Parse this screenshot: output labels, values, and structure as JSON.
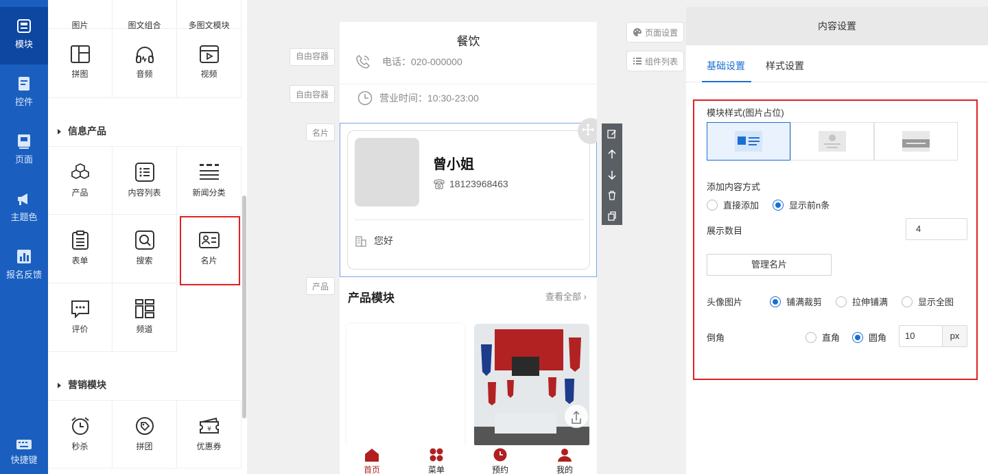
{
  "nav": {
    "items": [
      {
        "label": "模块",
        "icon": "module-icon"
      },
      {
        "label": "控件",
        "icon": "widget-icon"
      },
      {
        "label": "页面",
        "icon": "page-icon"
      },
      {
        "label": "主题色",
        "icon": "megaphone-icon"
      },
      {
        "label": "报名反馈",
        "icon": "chart-icon"
      },
      {
        "label": "快捷键",
        "icon": "keyboard-icon"
      }
    ]
  },
  "panel": {
    "top_row": [
      "图片",
      "图文组合",
      "多图文模块"
    ],
    "row_media": [
      "拼图",
      "音频",
      "视频"
    ],
    "section_info": "信息产品",
    "row_info1": [
      "产品",
      "内容列表",
      "新闻分类"
    ],
    "row_info2": [
      "表单",
      "搜索",
      "名片"
    ],
    "row_info3": [
      "评价",
      "频道"
    ],
    "section_marketing": "营销模块",
    "row_marketing": [
      "秒杀",
      "拼团",
      "优惠券"
    ]
  },
  "canvas": {
    "tags": {
      "free_container_1": "自由容器",
      "free_container_2": "自由容器",
      "card": "名片",
      "product": "产品"
    },
    "side_buttons": {
      "page_settings": "页面设置",
      "component_list": "组件列表"
    },
    "phone": {
      "title": "餐饮",
      "phone_line": "电话：020-000000",
      "hours_line": "营业时间：10:30-23:00",
      "card_name": "曾小姐",
      "card_phone": "18123968463",
      "card_greeting": "您好",
      "product_title": "产品模块",
      "view_all": "查看全部",
      "bottom_nav": [
        "首页",
        "菜单",
        "预约",
        "我的"
      ]
    }
  },
  "settings": {
    "header": "内容设置",
    "tabs": [
      "基础设置",
      "样式设置"
    ],
    "module_style_label": "模块样式(图片占位)",
    "add_method_label": "添加内容方式",
    "add_method_options": [
      "直接添加",
      "显示前n条"
    ],
    "add_method_selected": "显示前n条",
    "display_count_label": "展示数目",
    "display_count_value": "4",
    "manage_button": "管理名片",
    "avatar_label": "头像图片",
    "avatar_options": [
      "铺满裁剪",
      "拉伸铺满",
      "显示全图"
    ],
    "avatar_selected": "铺满裁剪",
    "corner_label": "倒角",
    "corner_options": [
      "直角",
      "圆角"
    ],
    "corner_selected": "圆角",
    "corner_value": "10",
    "corner_unit": "px"
  },
  "colors": {
    "nav_bg": "#1a5fbf",
    "accent": "#1a6fd1",
    "highlight_red": "#e02020",
    "brand_red": "#b02020"
  }
}
